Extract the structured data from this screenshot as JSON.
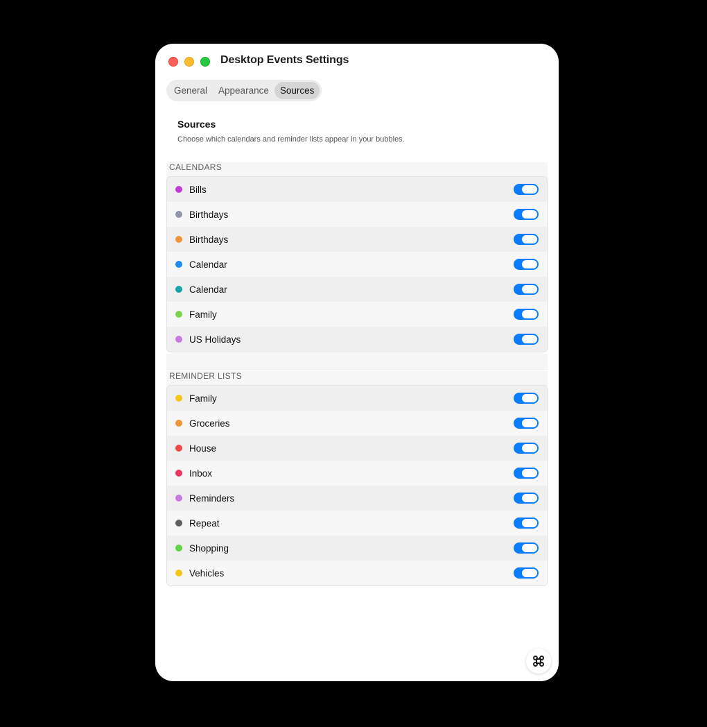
{
  "window": {
    "title": "Desktop Events Settings"
  },
  "tabs": [
    {
      "label": "General",
      "active": false
    },
    {
      "label": "Appearance",
      "active": false
    },
    {
      "label": "Sources",
      "active": true
    }
  ],
  "section": {
    "title": "Sources",
    "subtitle": "Choose which calendars and reminder lists appear in your bubbles."
  },
  "calendars": {
    "label": "CALENDARS",
    "items": [
      {
        "name": "Bills",
        "color": "#c43ad8",
        "enabled": true
      },
      {
        "name": "Birthdays",
        "color": "#8e96a8",
        "enabled": true
      },
      {
        "name": "Birthdays",
        "color": "#f0943a",
        "enabled": true
      },
      {
        "name": "Calendar",
        "color": "#1d8cf0",
        "enabled": true
      },
      {
        "name": "Calendar",
        "color": "#13a3a8",
        "enabled": true
      },
      {
        "name": "Family",
        "color": "#7fd44f",
        "enabled": true
      },
      {
        "name": "US Holidays",
        "color": "#c77ae0",
        "enabled": true
      }
    ]
  },
  "reminder_lists": {
    "label": "REMINDER LISTS",
    "items": [
      {
        "name": "Family",
        "color": "#f5c518",
        "enabled": true
      },
      {
        "name": "Groceries",
        "color": "#f0943a",
        "enabled": true
      },
      {
        "name": "House",
        "color": "#f04848",
        "enabled": true
      },
      {
        "name": "Inbox",
        "color": "#ec3462",
        "enabled": true
      },
      {
        "name": "Reminders",
        "color": "#c77ae0",
        "enabled": true
      },
      {
        "name": "Repeat",
        "color": "#5f5f5f",
        "enabled": true
      },
      {
        "name": "Shopping",
        "color": "#5fd444",
        "enabled": true
      },
      {
        "name": "Vehicles",
        "color": "#f5c518",
        "enabled": true
      }
    ]
  },
  "colors": {
    "toggle_on": "#0a7cff",
    "close": "#ff5f57",
    "minimize": "#febc2e",
    "maximize": "#28c840"
  },
  "icons": {
    "fab": "command-icon"
  }
}
